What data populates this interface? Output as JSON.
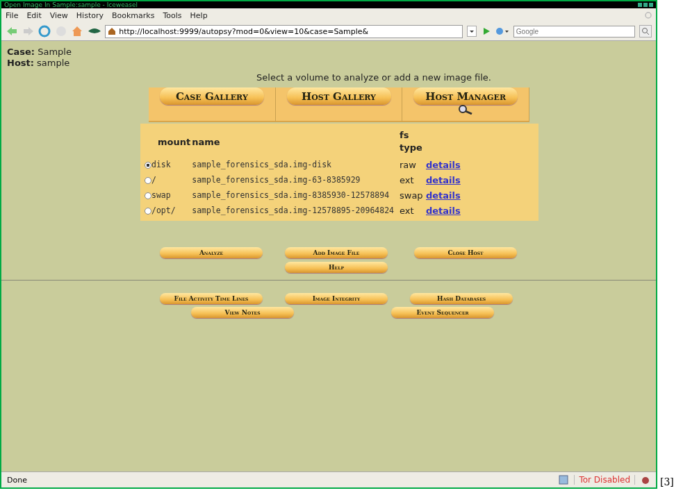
{
  "window": {
    "title": "Open Image In Sample:sample - Iceweasel"
  },
  "menu": [
    "File",
    "Edit",
    "View",
    "History",
    "Bookmarks",
    "Tools",
    "Help"
  ],
  "address_bar": {
    "value": "http://localhost:9999/autopsy?mod=0&view=10&case=Sample&"
  },
  "search": {
    "placeholder": "Google"
  },
  "case": {
    "label": "Case:",
    "value": "Sample"
  },
  "host": {
    "label": "Host:",
    "value": "sample"
  },
  "instruction": "Select a volume to analyze or add a new image file.",
  "gallery_tabs": [
    "Case Gallery",
    "Host Gallery",
    "Host Manager"
  ],
  "table": {
    "columns": [
      "mount",
      "name",
      "fs type"
    ],
    "rows": [
      {
        "selected": true,
        "mount": "disk",
        "name": "sample_forensics_sda.img-disk",
        "fs_type": "raw",
        "link": "details"
      },
      {
        "selected": false,
        "mount": "/",
        "name": "sample_forensics_sda.img-63-8385929",
        "fs_type": "ext",
        "link": "details"
      },
      {
        "selected": false,
        "mount": "swap",
        "name": "sample_forensics_sda.img-8385930-12578894",
        "fs_type": "swap",
        "link": "details"
      },
      {
        "selected": false,
        "mount": "/opt/",
        "name": "sample_forensics_sda.img-12578895-20964824",
        "fs_type": "ext",
        "link": "details"
      }
    ]
  },
  "actions": [
    "Analyze",
    "Add Image File",
    "Close Host"
  ],
  "help": "Help",
  "tools": [
    "File Activity Time Lines",
    "Image Integrity",
    "Hash Databases"
  ],
  "tools_row_2": [
    "View Notes",
    "Event Sequencer"
  ],
  "status_bar": {
    "text": "Done",
    "tor": "Tor Disabled"
  },
  "footnote": "[3]"
}
